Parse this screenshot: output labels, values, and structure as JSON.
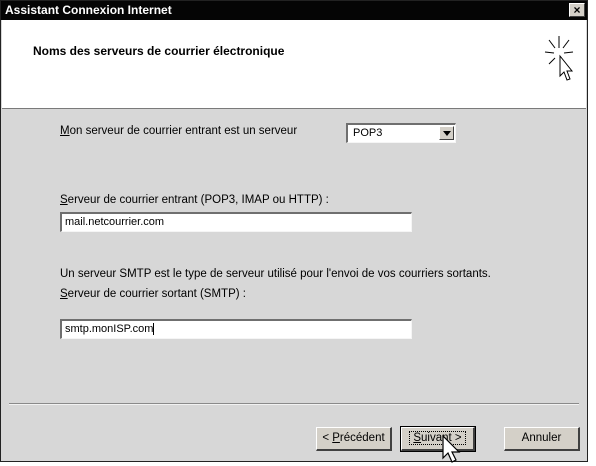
{
  "window": {
    "title": "Assistant Connexion Internet",
    "close_glyph": "×"
  },
  "header": {
    "title": "Noms des serveurs de courrier électronique",
    "icon": "wizard-cursor-icon"
  },
  "incoming_type": {
    "label_prefix": "M",
    "label_rest": "on serveur de courrier entrant est un serveur",
    "selected": "POP3"
  },
  "incoming_server": {
    "label_prefix": "S",
    "label_rest": "erveur de courrier entrant (POP3, IMAP ou HTTP) :",
    "value": "mail.netcourrier.com"
  },
  "smtp_info": "Un serveur SMTP est le type de serveur utilisé pour l'envoi de vos courriers sortants.",
  "outgoing_server": {
    "label_prefix": "S",
    "label_rest": "erveur de courrier sortant (SMTP) :",
    "value": "smtp.monISP.com"
  },
  "buttons": {
    "back": {
      "prefix": "< ",
      "accel": "P",
      "rest": "récédent"
    },
    "next": {
      "accel": "S",
      "rest": "uivant >"
    },
    "cancel": "Annuler"
  }
}
